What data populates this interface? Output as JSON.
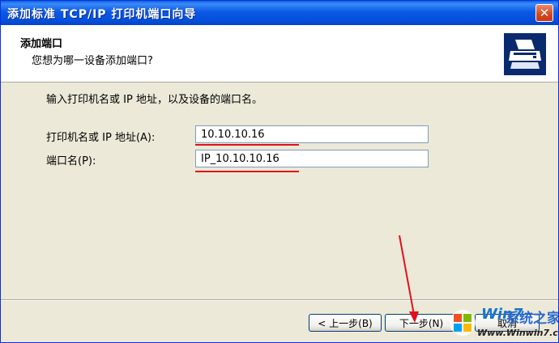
{
  "window": {
    "title": "添加标准 TCP/IP 打印机端口向导",
    "close_label": "✕"
  },
  "header": {
    "title": "添加端口",
    "subtitle": "您想为哪一设备添加端口?"
  },
  "form": {
    "instruction": "输入打印机名或 IP 地址，以及设备的端口名。",
    "host_label": "打印机名或 IP 地址(A):",
    "host_value": "10.10.10.16",
    "port_label": "端口名(P):",
    "port_value": "IP_10.10.10.16"
  },
  "buttons": {
    "back_label": "< 上一步(B)",
    "next_label": "下一步(N)",
    "cancel_label": "取消"
  },
  "watermark": {
    "logo": "Win7",
    "site_name": "系统之家",
    "url": "Www.Winwin7.com"
  },
  "colors": {
    "title_bar": "#0450dd",
    "annotation": "#e0101a"
  }
}
